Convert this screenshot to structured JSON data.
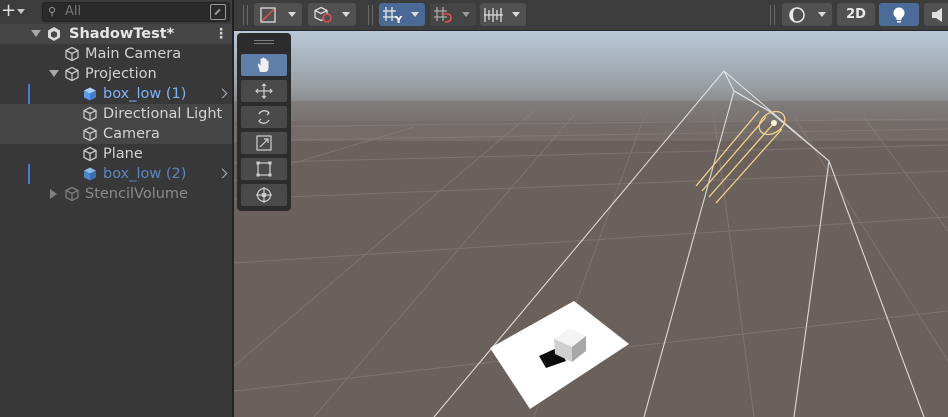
{
  "hierarchy": {
    "search_placeholder": "All",
    "scene_name": "ShadowTest*",
    "items": [
      {
        "label": "Main Camera",
        "color": "#d2d2d2"
      },
      {
        "label": "Projection",
        "color": "#d2d2d2"
      },
      {
        "label": "box_low (1)",
        "color": "#7fb1f5"
      },
      {
        "label": "Directional Light",
        "color": "#d2d2d2"
      },
      {
        "label": "Camera",
        "color": "#d2d2d2"
      },
      {
        "label": "Plane",
        "color": "#d2d2d2"
      },
      {
        "label": "box_low (2)",
        "color": "#5a86c5"
      },
      {
        "label": "StencilVolume",
        "color": "#8a8a8a"
      }
    ]
  },
  "scene_toolbar": {
    "mode_2d_label": "2D"
  },
  "colors": {
    "accent": "#3e7ed6",
    "active_button": "#4a6a95",
    "prefab_blue": "#7fb1f5",
    "sky_top": "#b9c9d9",
    "ground": "#6a615c"
  }
}
